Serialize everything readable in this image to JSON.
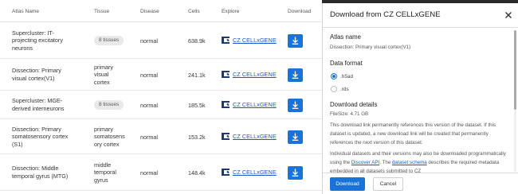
{
  "table": {
    "headers": [
      "Atlas Name",
      "Tissue",
      "Disease",
      "Cells",
      "Explore",
      "Download"
    ],
    "explore_label": "CZ CELLxGENE",
    "rows": [
      {
        "name_lines": [
          "Supercluster: IT-",
          "projecting excitatory",
          "neurons"
        ],
        "tissue_pill": "8 tissues",
        "tissue_lines": [],
        "disease": "normal",
        "cells": "638.9k"
      },
      {
        "name_lines": [
          "Dissection: Primary",
          "visual cortex(V1)"
        ],
        "tissue_pill": "",
        "tissue_lines": [
          "primary",
          "visual",
          "cortex"
        ],
        "disease": "normal",
        "cells": "241.1k"
      },
      {
        "name_lines": [
          "Supercluster: MGE-",
          "derived interneurons"
        ],
        "tissue_pill": "8 tissues",
        "tissue_lines": [],
        "disease": "normal",
        "cells": "185.5k"
      },
      {
        "name_lines": [
          "Dissection: Primary",
          "somatosensory cortex",
          "(S1)"
        ],
        "tissue_pill": "",
        "tissue_lines": [
          "primary",
          "somatosens",
          "ory cortex"
        ],
        "disease": "normal",
        "cells": "153.2k"
      },
      {
        "name_lines": [
          "Dissection: Middle",
          "temporal gyrus (MTG)"
        ],
        "tissue_pill": "",
        "tissue_lines": [
          "middle",
          "temporal",
          "gyrus"
        ],
        "disease": "normal",
        "cells": "148.4k"
      }
    ]
  },
  "modal": {
    "title": "Download from CZ CELLxGENE",
    "atlas_name_label": "Atlas name",
    "atlas_name_value": "Dissection: Primary visual cortex(V1)",
    "data_format_label": "Data format",
    "formats": [
      {
        "label": ".h5ad",
        "selected": true
      },
      {
        "label": ".rds",
        "selected": false
      }
    ],
    "details_label": "Download details",
    "file_size": "FileSize: 4.71 GB",
    "para1": "This download link permanently references this version of the dataset. If this dataset is updated, a new download link will be created that permanently references the next version of this dataset.",
    "para2_a": "Individual datasets and their versions may also be downloaded programmatically using the ",
    "para2_link1": "Discover API",
    "para2_b": ". The ",
    "para2_link2": "dataset schema",
    "para2_c": " describes the required metadata embedded in all datasets submitted to CZ",
    "download_button": "Download",
    "cancel_button": "Cancel"
  },
  "colors": {
    "accent": "#1a73d8",
    "link": "#1c56c8"
  }
}
